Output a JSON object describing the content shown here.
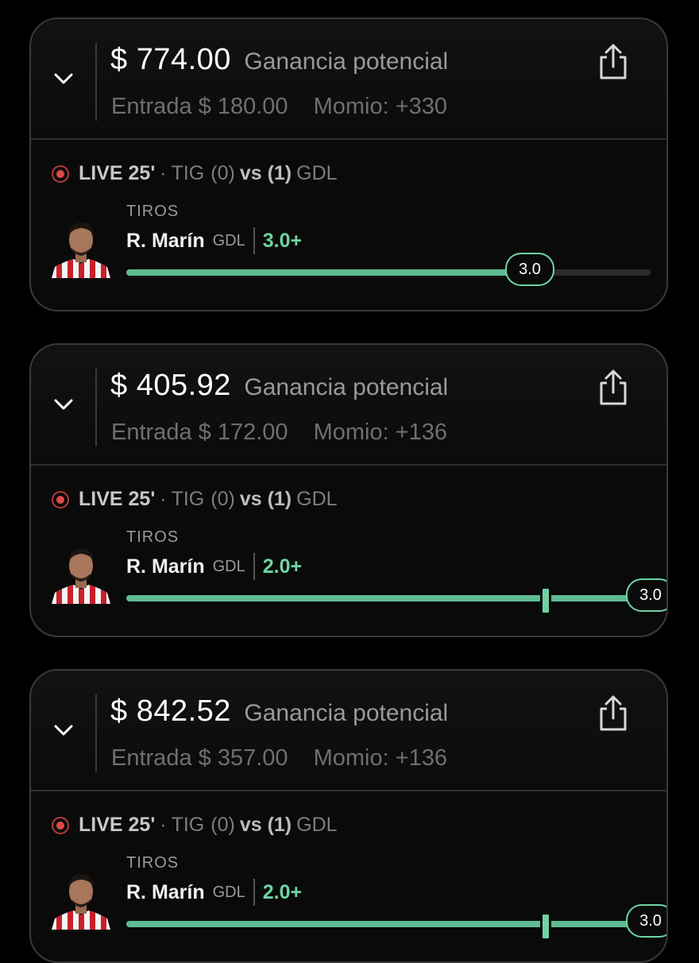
{
  "bets": [
    {
      "amount": "$ 774.00",
      "gain_label": "Ganancia potencial",
      "entry": "Entrada $ 180.00",
      "odds": "Momio: +330",
      "live": "LIVE 25'",
      "home_team": "TIG",
      "home_score": "(0)",
      "vs": "vs (1)",
      "away_team": "GDL",
      "market": "TIROS",
      "player": "R. Marín",
      "player_team": "GDL",
      "line": "3.0+",
      "current": "3.0",
      "progress": 0.77,
      "target_progress": null
    },
    {
      "amount": "$ 405.92",
      "gain_label": "Ganancia potencial",
      "entry": "Entrada $ 172.00",
      "odds": "Momio: +136",
      "live": "LIVE 25'",
      "home_team": "TIG",
      "home_score": "(0)",
      "vs": "vs (1)",
      "away_team": "GDL",
      "market": "TIROS",
      "player": "R. Marín",
      "player_team": "GDL",
      "line": "2.0+",
      "current": "3.0",
      "progress": 1.0,
      "target_progress": 0.8
    },
    {
      "amount": "$ 842.52",
      "gain_label": "Ganancia potencial",
      "entry": "Entrada $ 357.00",
      "odds": "Momio: +136",
      "live": "LIVE 25'",
      "home_team": "TIG",
      "home_score": "(0)",
      "vs": "vs (1)",
      "away_team": "GDL",
      "market": "TIROS",
      "player": "R. Marín",
      "player_team": "GDL",
      "line": "2.0+",
      "current": "3.0",
      "progress": 1.0,
      "target_progress": 0.8
    }
  ],
  "colors": {
    "accent": "#6fd3a3",
    "fill": "#5fba92",
    "live": "#e04848",
    "background": "#000000"
  },
  "icons": {
    "expand": "chevron-down-icon",
    "share": "share-icon",
    "live": "live-dot-icon",
    "avatar": "player-avatar"
  }
}
